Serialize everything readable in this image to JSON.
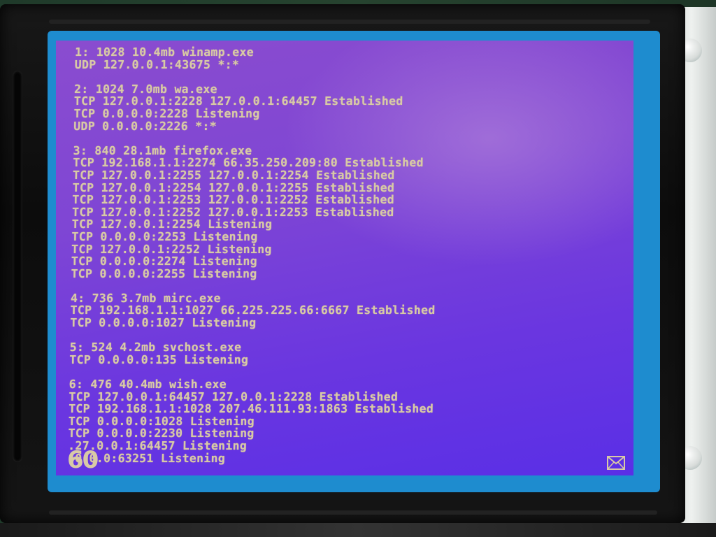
{
  "terminal": {
    "groups": [
      {
        "lines": [
          "1: 1028 10.4mb winamp.exe",
          "UDP 127.0.0.1:43675 *:*"
        ]
      },
      {
        "lines": [
          "2: 1024 7.0mb wa.exe",
          "TCP 127.0.0.1:2228 127.0.0.1:64457 Established",
          "TCP 0.0.0.0:2228 Listening",
          "UDP 0.0.0.0:2226 *:*"
        ]
      },
      {
        "lines": [
          "3: 840 28.1mb firefox.exe",
          "TCP 192.168.1.1:2274 66.35.250.209:80 Established",
          "TCP 127.0.0.1:2255 127.0.0.1:2254 Established",
          "TCP 127.0.0.1:2254 127.0.0.1:2255 Established",
          "TCP 127.0.0.1:2253 127.0.0.1:2252 Established",
          "TCP 127.0.0.1:2252 127.0.0.1:2253 Established",
          "TCP 127.0.0.1:2254 Listening",
          "TCP 0.0.0.0:2253 Listening",
          "TCP 127.0.0.1:2252 Listening",
          "TCP 0.0.0.0:2274 Listening",
          "TCP 0.0.0.0:2255 Listening"
        ]
      },
      {
        "lines": [
          "4: 736 3.7mb mirc.exe",
          "TCP 192.168.1.1:1027 66.225.225.66:6667 Established",
          "TCP 0.0.0.0:1027 Listening"
        ]
      },
      {
        "lines": [
          "5: 524 4.2mb svchost.exe",
          "TCP 0.0.0.0:135 Listening"
        ]
      },
      {
        "lines": [
          "6: 476 40.4mb wish.exe",
          "TCP 127.0.0.1:64457 127.0.0.1:2228 Established",
          "TCP 192.168.1.1:1028 207.46.111.93:1863 Established",
          "TCP 0.0.0.0:1028 Listening",
          "TCP 0.0.0.0:2230 Listening",
          ".27.0.0.1:64457 Listening",
          ".0.0.0:63251 Listening"
        ]
      }
    ]
  },
  "counter": "60",
  "icons": {
    "mail": "mail-icon"
  },
  "colors": {
    "text": "#d8c9a6",
    "screen": "#7040d8",
    "frame": "#1e8ccf"
  }
}
